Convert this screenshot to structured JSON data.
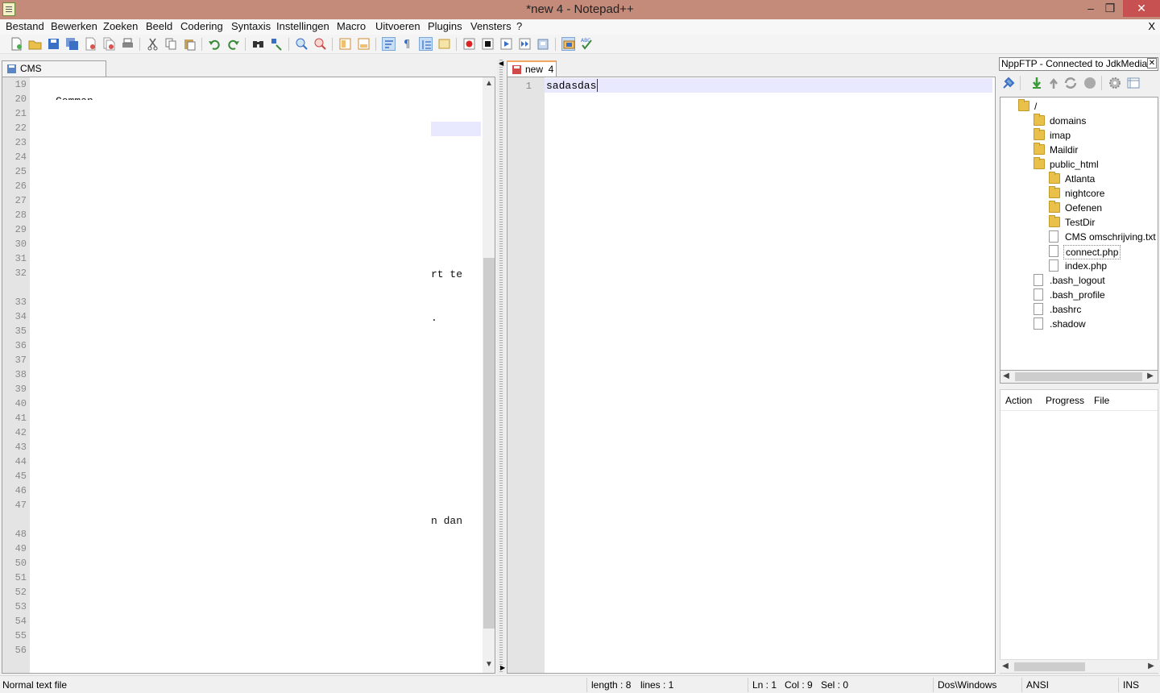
{
  "window": {
    "title": "*new  4 - Notepad++",
    "minimize": "–",
    "restore": "❒",
    "close": "✕"
  },
  "menu": {
    "items": [
      "Bestand",
      "Bewerken",
      "Zoeken",
      "Beeld",
      "Codering",
      "Syntaxis",
      "Instellingen",
      "Macro",
      "Uitvoeren",
      "Plugins",
      "Vensters",
      "?"
    ],
    "close": "X"
  },
  "toolbar": {
    "icons": [
      "new-file-icon",
      "open-file-icon",
      "save-icon",
      "save-all-icon",
      "close-file-icon",
      "close-all-icon",
      "print-icon",
      "cut-icon",
      "copy-icon",
      "paste-icon",
      "undo-icon",
      "redo-icon",
      "find-icon",
      "replace-icon",
      "zoom-in-icon",
      "zoom-out-icon",
      "sync-vertical-icon",
      "sync-horizontal-icon",
      "word-wrap-icon",
      "show-all-chars-icon",
      "indent-guide-icon",
      "doc-map-icon",
      "macro-record-icon",
      "macro-stop-icon",
      "macro-play-icon",
      "macro-run-multiple-icon",
      "macro-save-icon",
      "ftp-toggle-icon",
      "spell-check-icon"
    ]
  },
  "left_pane": {
    "tab_label": "CMS omschrijving.txt",
    "line_numbers": [
      "19",
      "20",
      "21",
      "22",
      "23",
      "24",
      "25",
      "26",
      "27",
      "28",
      "29",
      "30",
      "31",
      "32",
      "33",
      "34",
      "35",
      "36",
      "37",
      "38",
      "39",
      "40",
      "41",
      "42",
      "43",
      "44",
      "45",
      "46",
      "47",
      "48",
      "49",
      "50",
      "51",
      "52",
      "53",
      "54",
      "55",
      "56"
    ],
    "snippets": {
      "line20": "Comman",
      "line32": "rt te",
      "line34": ".",
      "line47": "n dan"
    }
  },
  "right_pane": {
    "tab_label": "new  4",
    "line_number": "1",
    "text": "sadasdas"
  },
  "ftp": {
    "title": "NppFTP - Connected to JdkMedia",
    "close": "✕",
    "toolbar_icons": [
      "connect-icon",
      "download-icon",
      "upload-icon",
      "refresh-icon",
      "abort-icon",
      "settings-icon",
      "message-window-icon"
    ],
    "tree": [
      {
        "label": "/",
        "type": "folder",
        "depth": 0
      },
      {
        "label": "domains",
        "type": "folder",
        "depth": 1
      },
      {
        "label": "imap",
        "type": "folder",
        "depth": 1
      },
      {
        "label": "Maildir",
        "type": "folder",
        "depth": 1
      },
      {
        "label": "public_html",
        "type": "folder",
        "depth": 1
      },
      {
        "label": "Atlanta",
        "type": "folder",
        "depth": 2
      },
      {
        "label": "nightcore",
        "type": "folder",
        "depth": 2
      },
      {
        "label": "Oefenen",
        "type": "folder",
        "depth": 2
      },
      {
        "label": "TestDir",
        "type": "folder",
        "depth": 2
      },
      {
        "label": "CMS omschrijving.txt",
        "type": "file",
        "depth": 2
      },
      {
        "label": "connect.php",
        "type": "file",
        "depth": 2,
        "selected": true
      },
      {
        "label": "index.php",
        "type": "file",
        "depth": 2
      },
      {
        "label": ".bash_logout",
        "type": "file",
        "depth": 1
      },
      {
        "label": ".bash_profile",
        "type": "file",
        "depth": 1
      },
      {
        "label": ".bashrc",
        "type": "file",
        "depth": 1
      },
      {
        "label": ".shadow",
        "type": "file",
        "depth": 1
      }
    ],
    "queue_headers": [
      "Action",
      "Progress",
      "File"
    ]
  },
  "status": {
    "file_type": "Normal text file",
    "length": "length : 8",
    "lines": "lines : 1",
    "ln": "Ln : 1",
    "col": "Col : 9",
    "sel": "Sel : 0",
    "eol": "Dos\\Windows",
    "encoding": "ANSI",
    "mode": "INS"
  },
  "colors": {
    "titlebar": "#c48a7a",
    "close_button": "#c75050",
    "gutter": "#e4e4e4",
    "current_line": "#e8e8ff",
    "caret": "#800080"
  }
}
